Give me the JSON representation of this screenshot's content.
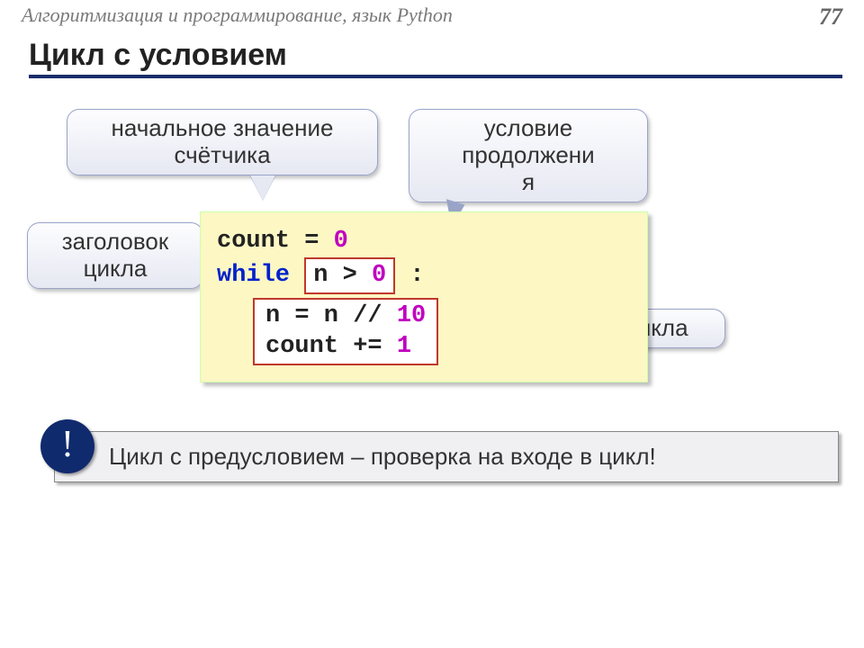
{
  "header": {
    "subject": "Алгоритмизация и программирование, язык Python",
    "page": "77"
  },
  "title": "Цикл с условием",
  "callouts": {
    "initial": "начальное значение счётчика",
    "condition_l1": "условие",
    "condition_l2": "продолжени",
    "condition_l3": "я",
    "loop_header_l1": "заголовок",
    "loop_header_l2": "цикла",
    "body": "тело цикла"
  },
  "code": {
    "l1a": "count",
    "l1b": " = ",
    "l1c": "0",
    "l2a": "while",
    "cond_a": "n > ",
    "cond_b": "0",
    "l2c": " :",
    "body_a": "n = n // ",
    "body_b": "10",
    "body_c": "count += ",
    "body_d": "1"
  },
  "tip": {
    "mark": "!",
    "text": " Цикл с предусловием – проверка на входе в цикл!"
  }
}
